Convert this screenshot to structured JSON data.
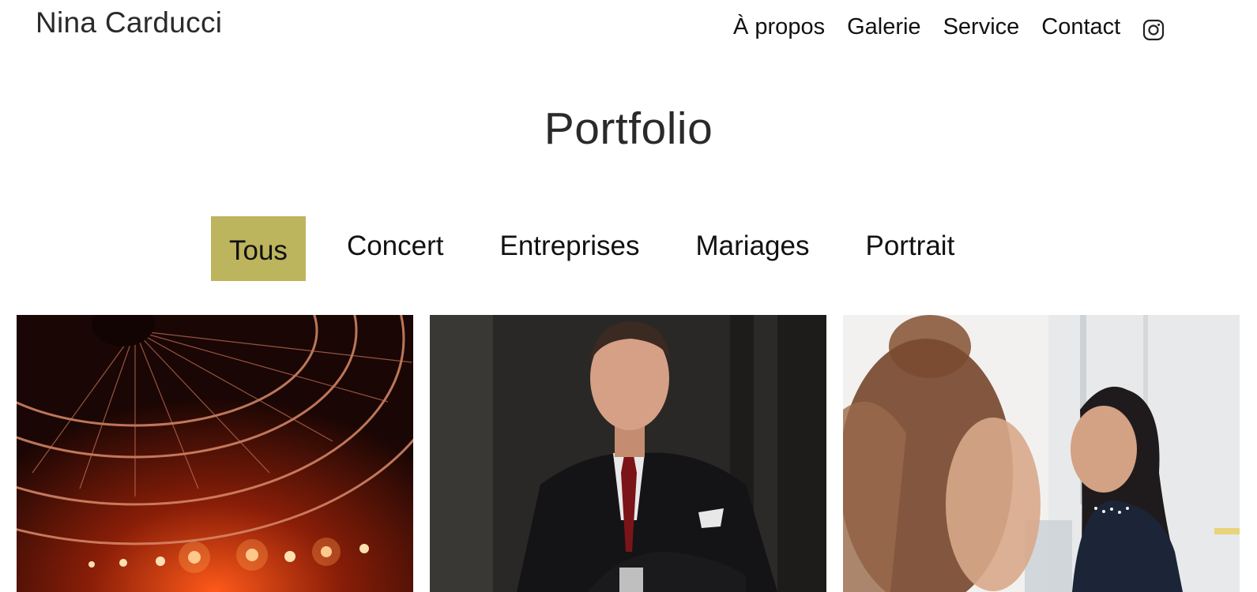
{
  "header": {
    "brand": "Nina Carducci",
    "nav": [
      "À propos",
      "Galerie",
      "Service",
      "Contact"
    ],
    "social_icon": "instagram-icon"
  },
  "main": {
    "title": "Portfolio",
    "filters": [
      {
        "label": "Tous",
        "active": true
      },
      {
        "label": "Concert",
        "active": false
      },
      {
        "label": "Entreprises",
        "active": false
      },
      {
        "label": "Mariages",
        "active": false
      },
      {
        "label": "Portrait",
        "active": false
      }
    ],
    "gallery": [
      {
        "subject": "concert-stage-lights"
      },
      {
        "subject": "businessman-portrait"
      },
      {
        "subject": "office-meeting-women"
      }
    ]
  },
  "colors": {
    "accent": "#bdb45e",
    "text": "#111111",
    "background": "#ffffff"
  }
}
